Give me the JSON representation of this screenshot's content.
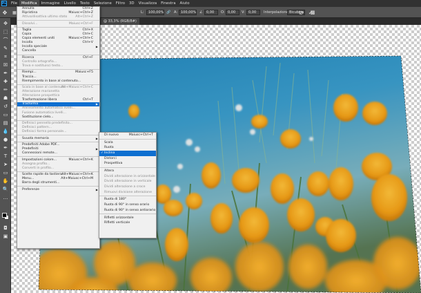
{
  "app_logo": "Ps",
  "menubar": [
    "File",
    "Modifica",
    "Immagine",
    "Livello",
    "Testo",
    "Selezione",
    "Filtro",
    "3D",
    "Visualizza",
    "Finestra",
    "Aiuto"
  ],
  "options": {
    "x_label": "X:",
    "y_label": "Y:",
    "w_label": "L:",
    "h_label": "A:",
    "w_value": "100,00%",
    "h_value": "100,00%",
    "angle_value": "0,00",
    "hskew_label": "O:",
    "vskew_label": "V:",
    "hskew_value": "0,00",
    "vskew_value": "0,00",
    "interp_label": "Interpolazione:",
    "interp_value": "Bicubica"
  },
  "document_tab": "@ 33,3% (RGB/8#) ×",
  "edit_menu": [
    {
      "label": "Annulla",
      "shortcut": "Ctrl+Z",
      "disabled": false
    },
    {
      "label": "Ripristina",
      "shortcut": "Maiusc+Ctrl+Z",
      "disabled": false
    },
    {
      "label": "Attiva/disattiva ultimo stato",
      "shortcut": "Alt+Ctrl+Z",
      "disabled": true
    },
    {
      "sep": true
    },
    {
      "label": "Dissolvi...",
      "shortcut": "Maiusc+Ctrl+F",
      "disabled": true
    },
    {
      "sep": true
    },
    {
      "label": "Taglia",
      "shortcut": "Ctrl+X",
      "disabled": false
    },
    {
      "label": "Copia",
      "shortcut": "Ctrl+C",
      "disabled": false
    },
    {
      "label": "Copia elementi uniti",
      "shortcut": "Maiusc+Ctrl+C",
      "disabled": false
    },
    {
      "label": "Incolla",
      "shortcut": "Ctrl+V",
      "disabled": false
    },
    {
      "label": "Incolla speciale",
      "submenu": true,
      "disabled": false
    },
    {
      "label": "Cancella",
      "disabled": false
    },
    {
      "sep": true
    },
    {
      "label": "Ricerca",
      "shortcut": "Ctrl+F",
      "disabled": false
    },
    {
      "label": "Controllo ortografia...",
      "disabled": true
    },
    {
      "label": "Trova e sostituisci testo...",
      "disabled": true
    },
    {
      "sep": true
    },
    {
      "label": "Riempi...",
      "shortcut": "Maiusc+F5",
      "disabled": false
    },
    {
      "label": "Traccia...",
      "disabled": false
    },
    {
      "label": "Riempimento in base al contenuto...",
      "disabled": false
    },
    {
      "sep": true
    },
    {
      "label": "Scala in base al contenuto",
      "shortcut": "Alt+Maiusc+Ctrl+C",
      "disabled": true
    },
    {
      "label": "Alterazione marionetta",
      "disabled": true
    },
    {
      "label": "Alterazione prospettica",
      "disabled": true
    },
    {
      "label": "Trasformazione libera",
      "shortcut": "Ctrl+T",
      "disabled": false
    },
    {
      "label": "Trasforma",
      "submenu": true,
      "disabled": false,
      "highlighted": true
    },
    {
      "label": "Allineamento automatico livelli...",
      "disabled": true
    },
    {
      "label": "Fusione automatica livelli...",
      "disabled": true
    },
    {
      "label": "Sostituzione cielo...",
      "disabled": false
    },
    {
      "sep": true
    },
    {
      "label": "Definisci pennello predefinito...",
      "disabled": true
    },
    {
      "label": "Definisci pattern...",
      "disabled": true
    },
    {
      "label": "Definisci forma personale...",
      "disabled": true
    },
    {
      "sep": true
    },
    {
      "label": "Svuota memoria",
      "submenu": true,
      "disabled": false
    },
    {
      "sep": true
    },
    {
      "label": "Predefiniti Adobe PDF...",
      "disabled": false
    },
    {
      "label": "Predefiniti",
      "submenu": true,
      "disabled": false
    },
    {
      "label": "Connessioni remote...",
      "disabled": false
    },
    {
      "sep": true
    },
    {
      "label": "Impostazioni colore...",
      "shortcut": "Maiusc+Ctrl+K",
      "disabled": false
    },
    {
      "label": "Assegna profilo...",
      "disabled": true
    },
    {
      "label": "Converti in profilo...",
      "disabled": true
    },
    {
      "sep": true
    },
    {
      "label": "Scelte rapide da tastiera...",
      "shortcut": "Alt+Maiusc+Ctrl+K",
      "disabled": false
    },
    {
      "label": "Menu...",
      "shortcut": "Alt+Maiusc+Ctrl+M",
      "disabled": false
    },
    {
      "label": "Barra degli strumenti...",
      "disabled": false
    },
    {
      "sep": true
    },
    {
      "label": "Preferenze",
      "submenu": true,
      "disabled": false
    }
  ],
  "transform_menu": [
    {
      "label": "Di nuovo",
      "shortcut": "Maiusc+Ctrl+T",
      "disabled": false
    },
    {
      "sep": true
    },
    {
      "label": "Scala",
      "disabled": false
    },
    {
      "label": "Ruota",
      "disabled": false
    },
    {
      "label": "Inclina",
      "disabled": false,
      "checked": true,
      "highlighted": true
    },
    {
      "label": "Distorci",
      "disabled": false
    },
    {
      "label": "Prospettiva",
      "disabled": false
    },
    {
      "sep": true
    },
    {
      "label": "Altera",
      "disabled": false
    },
    {
      "label": "Dividi alterazione in orizzontale",
      "disabled": true
    },
    {
      "label": "Dividi alterazione in verticale",
      "disabled": true
    },
    {
      "label": "Dividi alterazione a croce",
      "disabled": true
    },
    {
      "label": "Rimuovi divisione alterazione",
      "disabled": true
    },
    {
      "sep": true
    },
    {
      "label": "Ruota di 180°",
      "disabled": false
    },
    {
      "label": "Ruota di 90° in senso orario",
      "disabled": false
    },
    {
      "label": "Ruota di 90° in senso antiorario",
      "disabled": false
    },
    {
      "sep": true
    },
    {
      "label": "Rifletti orizzontale",
      "disabled": false
    },
    {
      "label": "Rifletti verticale",
      "disabled": false
    }
  ]
}
